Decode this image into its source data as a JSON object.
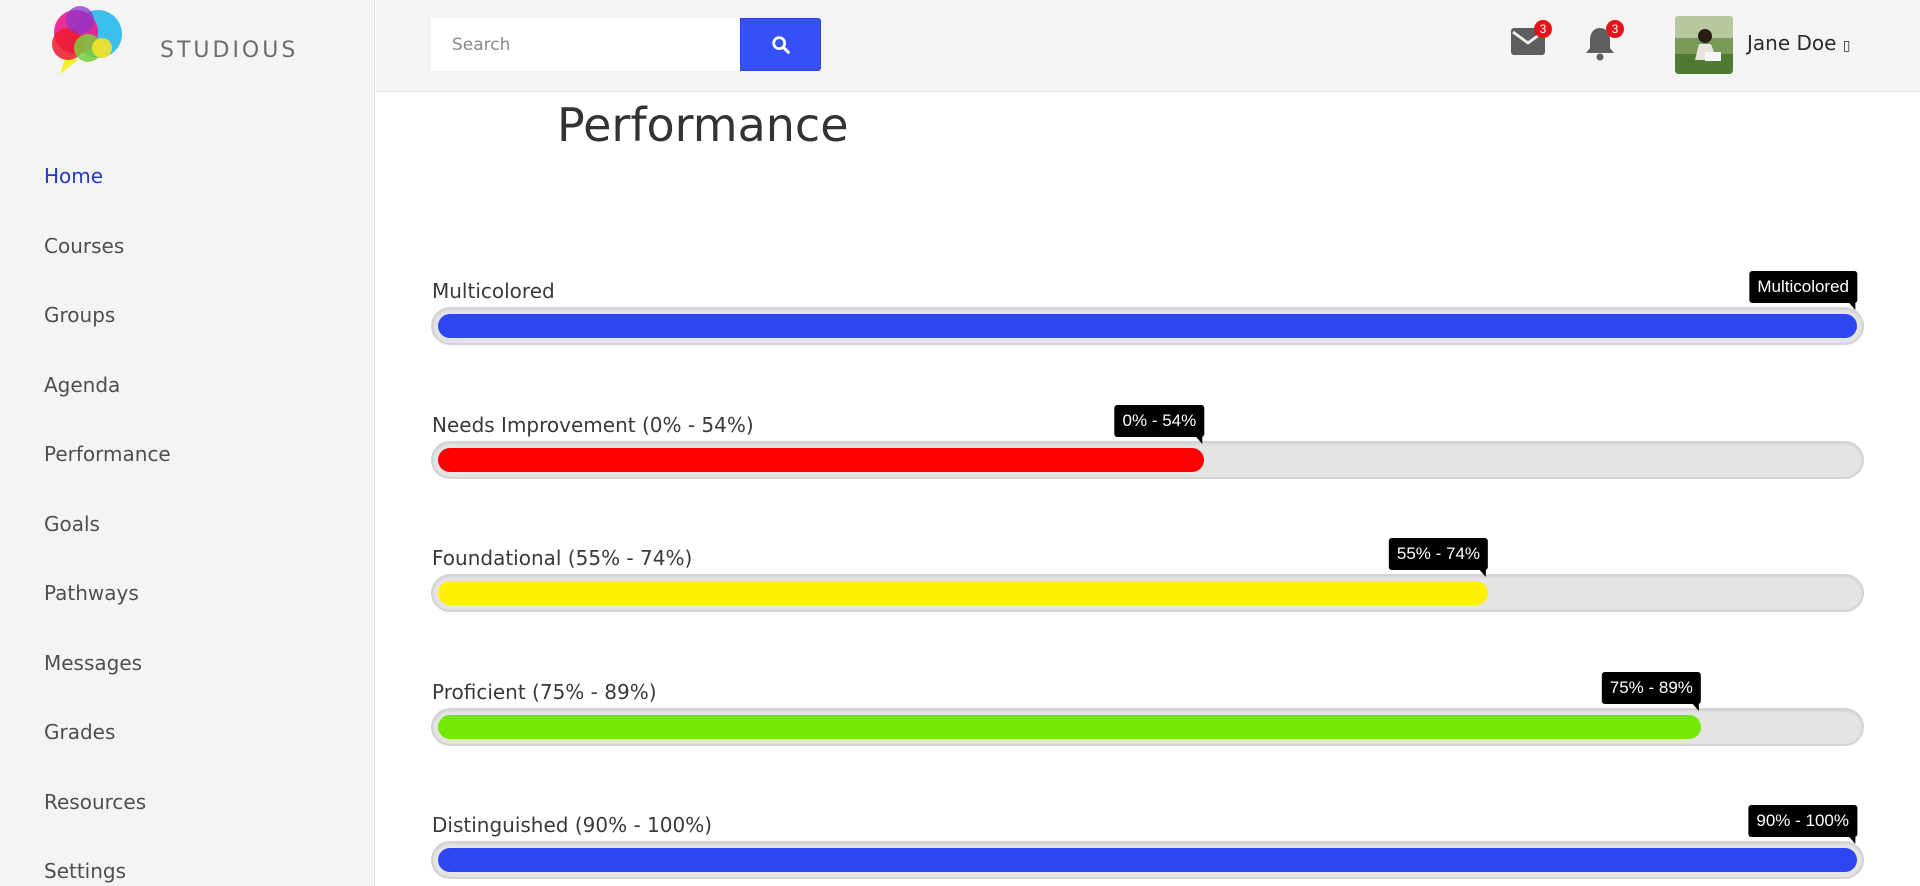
{
  "app": {
    "brand": "STUDIOUS"
  },
  "sidebar": {
    "items": [
      {
        "label": "Home",
        "active": true
      },
      {
        "label": "Courses"
      },
      {
        "label": "Groups"
      },
      {
        "label": "Agenda"
      },
      {
        "label": "Performance"
      },
      {
        "label": "Goals"
      },
      {
        "label": "Pathways"
      },
      {
        "label": "Messages"
      },
      {
        "label": "Grades"
      },
      {
        "label": "Resources"
      },
      {
        "label": "Settings"
      }
    ]
  },
  "header": {
    "search_placeholder": "Search",
    "search_icon": "magnifier-icon",
    "messages_count": "3",
    "notifications_count": "3",
    "user_name": "Jane Doe",
    "user_menu_glyph": "▯"
  },
  "main": {
    "title": "Performance",
    "bars": [
      {
        "label": "Multicolored",
        "tooltip": "Multicolored",
        "fill_percent": 100,
        "color": "#2d47f2"
      },
      {
        "label": "Needs Improvement (0% - 54%)",
        "tooltip": "0% - 54%",
        "fill_percent": 54,
        "color": "#ff0000"
      },
      {
        "label": "Foundational (55% - 74%)",
        "tooltip": "55% - 74%",
        "fill_percent": 74,
        "color": "#fff200"
      },
      {
        "label": "Proficient (75% - 89%)",
        "tooltip": "75% - 89%",
        "fill_percent": 89,
        "color": "#72e804"
      },
      {
        "label": "Distinguished (90% - 100%)",
        "tooltip": "90% - 100%",
        "fill_percent": 100,
        "color": "#2d47f2"
      }
    ]
  },
  "colors": {
    "accent": "#3651f7",
    "nav_active": "#2338c9",
    "badge": "#e5141b"
  }
}
